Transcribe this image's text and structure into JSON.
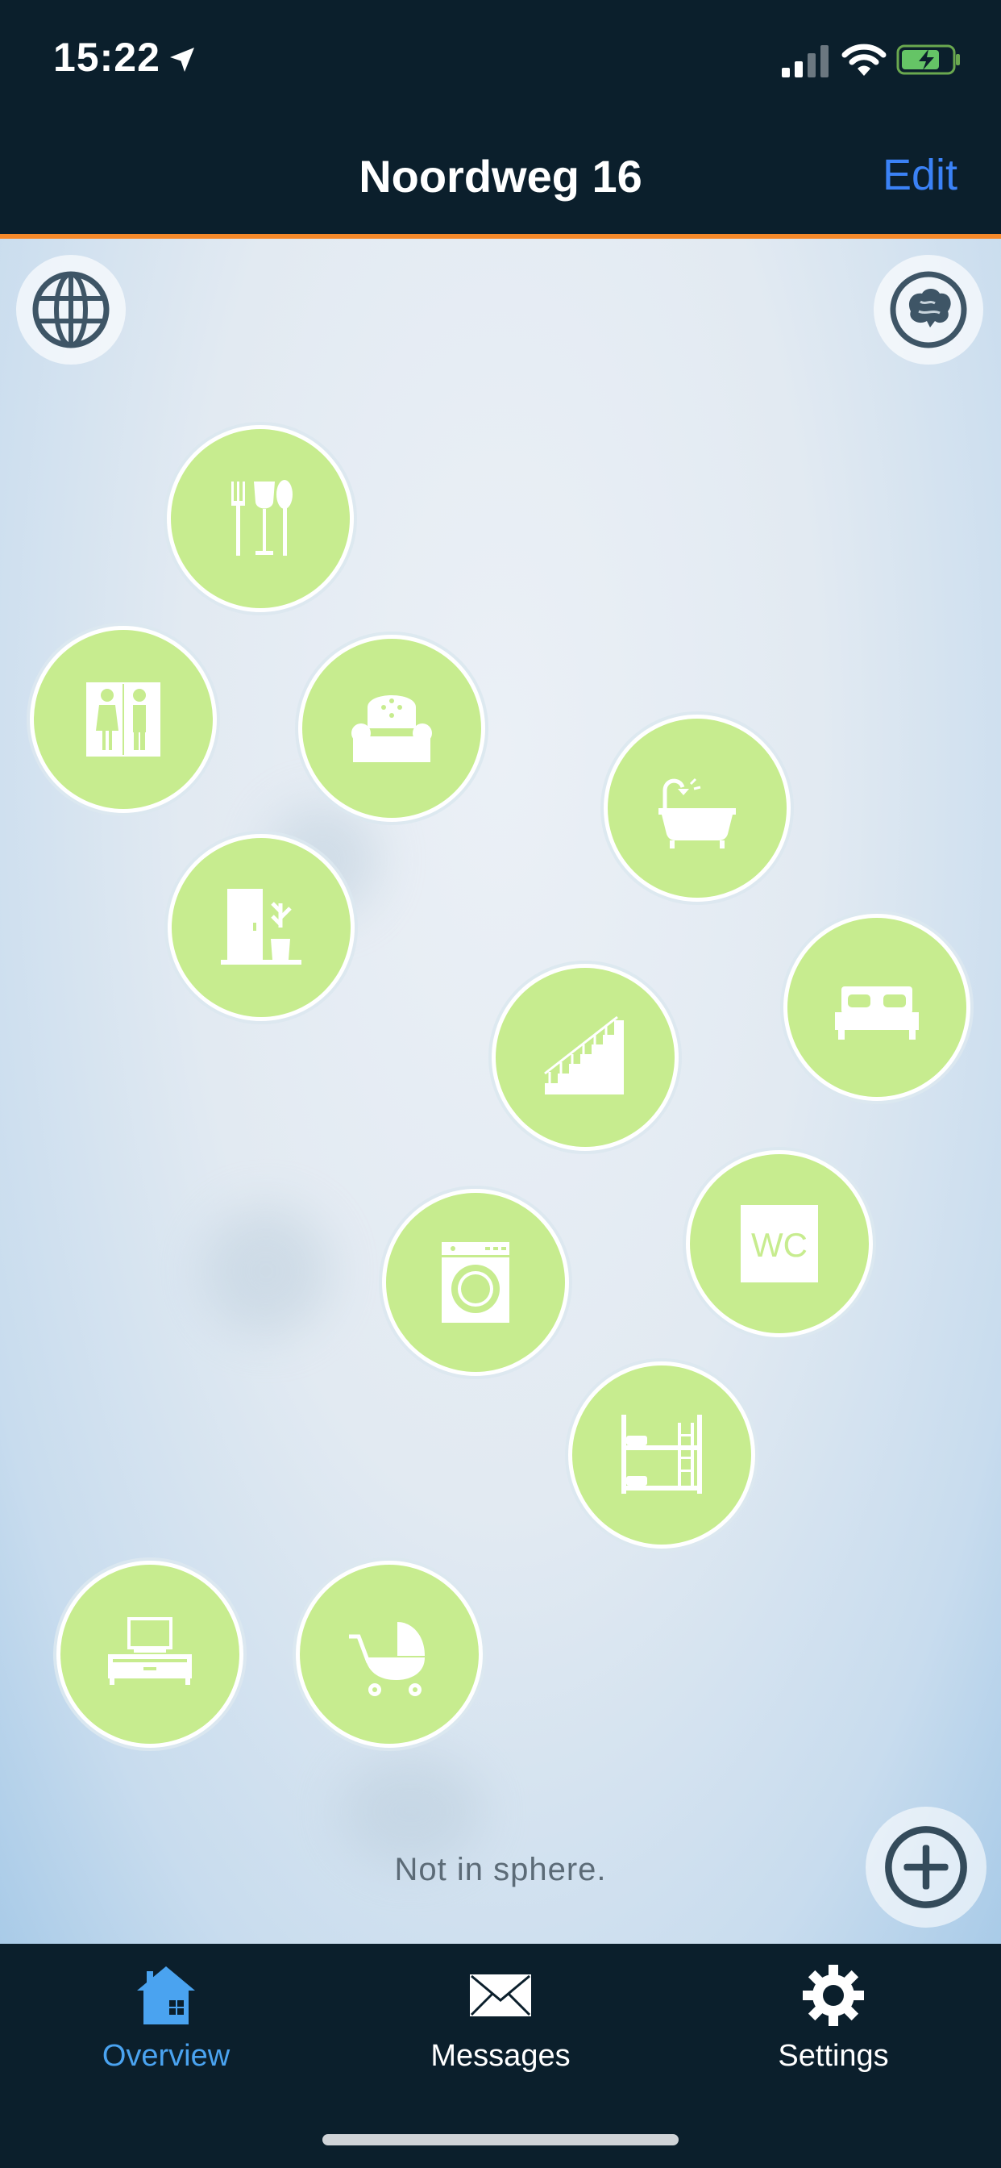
{
  "status_bar": {
    "time": "15:22"
  },
  "nav": {
    "title": "Noordweg 16",
    "edit_label": "Edit"
  },
  "main": {
    "status_text": "Not in sphere.",
    "rooms": [
      {
        "name": "dining"
      },
      {
        "name": "toilets-people"
      },
      {
        "name": "living-room"
      },
      {
        "name": "bathroom"
      },
      {
        "name": "hallway"
      },
      {
        "name": "bedroom"
      },
      {
        "name": "stairs"
      },
      {
        "name": "wc",
        "label": "WC"
      },
      {
        "name": "laundry"
      },
      {
        "name": "kids-bedroom"
      },
      {
        "name": "tv-room"
      },
      {
        "name": "nursery"
      }
    ]
  },
  "tabs": [
    {
      "label": "Overview",
      "icon": "home-icon",
      "active": true
    },
    {
      "label": "Messages",
      "icon": "envelope-icon",
      "active": false
    },
    {
      "label": "Settings",
      "icon": "gear-icon",
      "active": false
    }
  ],
  "colors": {
    "room_fill": "#c7ec8f",
    "accent_line": "#f6892a",
    "active_tab": "#4aa3f0",
    "edit": "#3b82f6",
    "bar_bg": "#0b1f2c"
  }
}
